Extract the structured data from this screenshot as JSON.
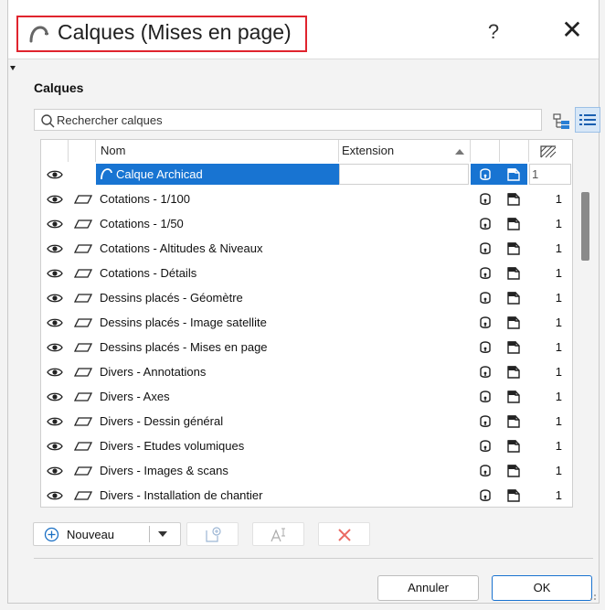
{
  "window": {
    "title": "Calques (Mises en page)",
    "help_label": "?",
    "close_label": "✕"
  },
  "section_title": "Calques",
  "search": {
    "placeholder": "Rechercher calques",
    "value": ""
  },
  "table": {
    "headers": {
      "name": "Nom",
      "extension": "Extension"
    },
    "selected_row": {
      "name": "Calque Archicad",
      "extension": "",
      "number": "1"
    },
    "rows": [
      {
        "name": "Cotations - 1/100",
        "number": "1"
      },
      {
        "name": "Cotations - 1/50",
        "number": "1"
      },
      {
        "name": "Cotations - Altitudes & Niveaux",
        "number": "1"
      },
      {
        "name": "Cotations - Détails",
        "number": "1"
      },
      {
        "name": "Dessins placés - Géomètre",
        "number": "1"
      },
      {
        "name": "Dessins placés - Image satellite",
        "number": "1"
      },
      {
        "name": "Dessins placés - Mises en page",
        "number": "1"
      },
      {
        "name": "Divers - Annotations",
        "number": "1"
      },
      {
        "name": "Divers - Axes",
        "number": "1"
      },
      {
        "name": "Divers - Dessin général",
        "number": "1"
      },
      {
        "name": "Divers - Etudes volumiques",
        "number": "1"
      },
      {
        "name": "Divers - Images & scans",
        "number": "1"
      },
      {
        "name": "Divers - Installation de chantier",
        "number": "1"
      }
    ]
  },
  "toolbar": {
    "new_label": "Nouveau"
  },
  "footer": {
    "cancel_label": "Annuler",
    "ok_label": "OK"
  },
  "colors": {
    "selection": "#1874d2",
    "highlight_border": "#e0242e",
    "delete": "#e8483f"
  }
}
